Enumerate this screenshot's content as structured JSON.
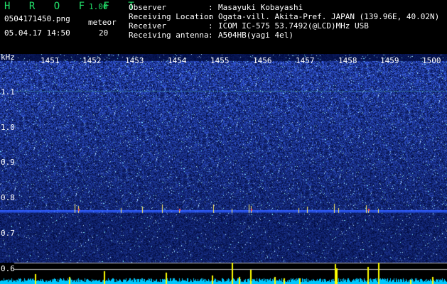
{
  "header": {
    "title": "H R O F F T",
    "version": "1.00",
    "filename": "0504171450.png",
    "datetime": "05.04.17 14:50",
    "meteor_label": "meteor",
    "meteor_count": "20"
  },
  "info": [
    {
      "key": "Observer",
      "value": "Masayuki Kobayashi"
    },
    {
      "key": "Receiving Location",
      "value": "Ogata-vill. Akita-Pref. JAPAN (139.96E, 40.02N)"
    },
    {
      "key": "Receiver",
      "value": "ICOM IC-575 53.7492(@LCD)MHz USB"
    },
    {
      "key": "Receiving antenna",
      "value": "A504HB(yagi 4el)"
    }
  ],
  "axis": {
    "unit": "kHz",
    "freq_labels": [
      "1.1",
      "1.0",
      "0.9",
      "0.8",
      "0.7",
      "0.6"
    ],
    "time_labels": [
      "1451",
      "1452",
      "1453",
      "1454",
      "1455",
      "1456",
      "1457",
      "1458",
      "1459",
      "1500"
    ]
  },
  "colors": {
    "spectrogram_bg": "#0a1a6e",
    "signal_line": "#2f5cff",
    "bar_color": "#ffff00",
    "noise_floor": "#00c8ff"
  }
}
